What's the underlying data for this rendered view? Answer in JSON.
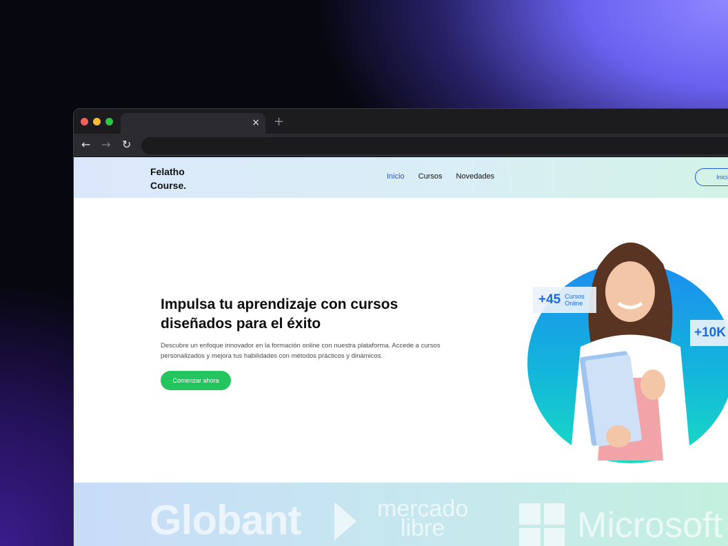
{
  "browser": {
    "tab_close": "×",
    "new_tab": "+",
    "back": "←",
    "forward": "→",
    "reload": "↻"
  },
  "site": {
    "logo_line1": "Felatho",
    "logo_line2": "Course.",
    "nav": [
      "Inicio",
      "Cursos",
      "Novedades"
    ],
    "login_button": "Iniciar Se",
    "hero": {
      "title": "Impulsa tu aprendizaje con cursos diseñados para el éxito",
      "description": "Descubre un enfoque innovador en la formación online con nuestra plataforma. Accede a cursos personalizados y mejora tus habilidades con métodos prácticos y dinámicos.",
      "cta": "Comenzar ahora"
    },
    "stats": [
      {
        "number": "+45",
        "label_line1": "Cursos",
        "label_line2": "Online"
      },
      {
        "number": "+10K"
      }
    ],
    "brands": {
      "globant": "Globant",
      "mercado_line1": "mercado",
      "mercado_line2": "libre",
      "microsoft": "Microsoft"
    }
  },
  "colors": {
    "accent": "#2357d6",
    "cta": "#22c55e",
    "stat": "#1d6ae6"
  }
}
